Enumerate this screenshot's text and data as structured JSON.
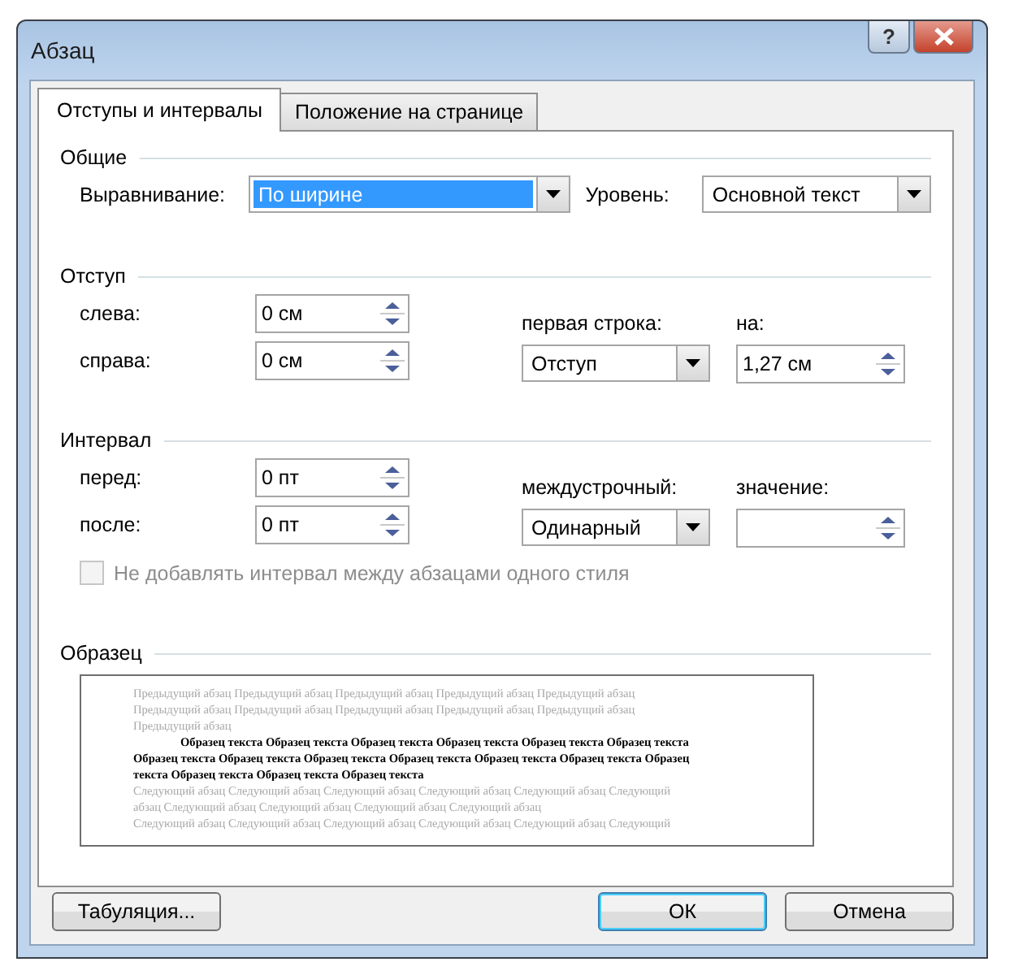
{
  "window": {
    "title": "Абзац",
    "help": "?"
  },
  "tabs": [
    {
      "label": "Отступы и интервалы",
      "selected": true
    },
    {
      "label": "Положение на странице",
      "selected": false
    }
  ],
  "general": {
    "heading": "Общие",
    "alignment": {
      "label": "Выравнивание:",
      "value": "По ширине",
      "highlighted": true
    },
    "level": {
      "label": "Уровень:",
      "value": "Основной текст",
      "highlighted": false
    }
  },
  "indent": {
    "heading": "Отступ",
    "left": {
      "label": "слева:",
      "value": "0 см"
    },
    "right": {
      "label": "справа:",
      "value": "0 см"
    },
    "first_line": {
      "label": "первая строка:",
      "value": "Отступ",
      "highlighted": false
    },
    "by": {
      "label": "на:",
      "value": "1,27 см"
    }
  },
  "spacing": {
    "heading": "Интервал",
    "before": {
      "label": "перед:",
      "value": "0 пт"
    },
    "after": {
      "label": "после:",
      "value": "0 пт"
    },
    "line_spacing": {
      "label": "междустрочный:",
      "value": "Одинарный",
      "highlighted": false
    },
    "at": {
      "label": "значение:"
    }
  },
  "no_space_checkbox": {
    "label": "Не добавлять интервал между абзацами одного стиля",
    "checked": false,
    "disabled": true
  },
  "preview": {
    "heading": "Образец",
    "previous_lines": [
      "Предыдущий абзац Предыдущий абзац Предыдущий абзац Предыдущий абзац Предыдущий абзац",
      "Предыдущий абзац Предыдущий абзац Предыдущий абзац Предыдущий абзац Предыдущий абзац",
      "Предыдущий абзац"
    ],
    "sample_lines": [
      "Образец текста Образец текста Образец текста Образец текста Образец текста Образец текста",
      "Образец текста Образец текста Образец текста Образец текста Образец текста Образец текста Образец",
      "текста Образец текста Образец текста Образец текста"
    ],
    "next_lines": [
      "Следующий абзац Следующий абзац Следующий абзац Следующий абзац Следующий абзац Следующий",
      "абзац Следующий абзац Следующий абзац Следующий абзац Следующий абзац",
      "Следующий абзац Следующий абзац Следующий абзац Следующий абзац Следующий абзац Следующий"
    ]
  },
  "buttons": [
    {
      "label": "Табуляция...",
      "default": false
    },
    {
      "label": "ОК",
      "default": true
    },
    {
      "label": "Отмена",
      "default": false
    }
  ]
}
